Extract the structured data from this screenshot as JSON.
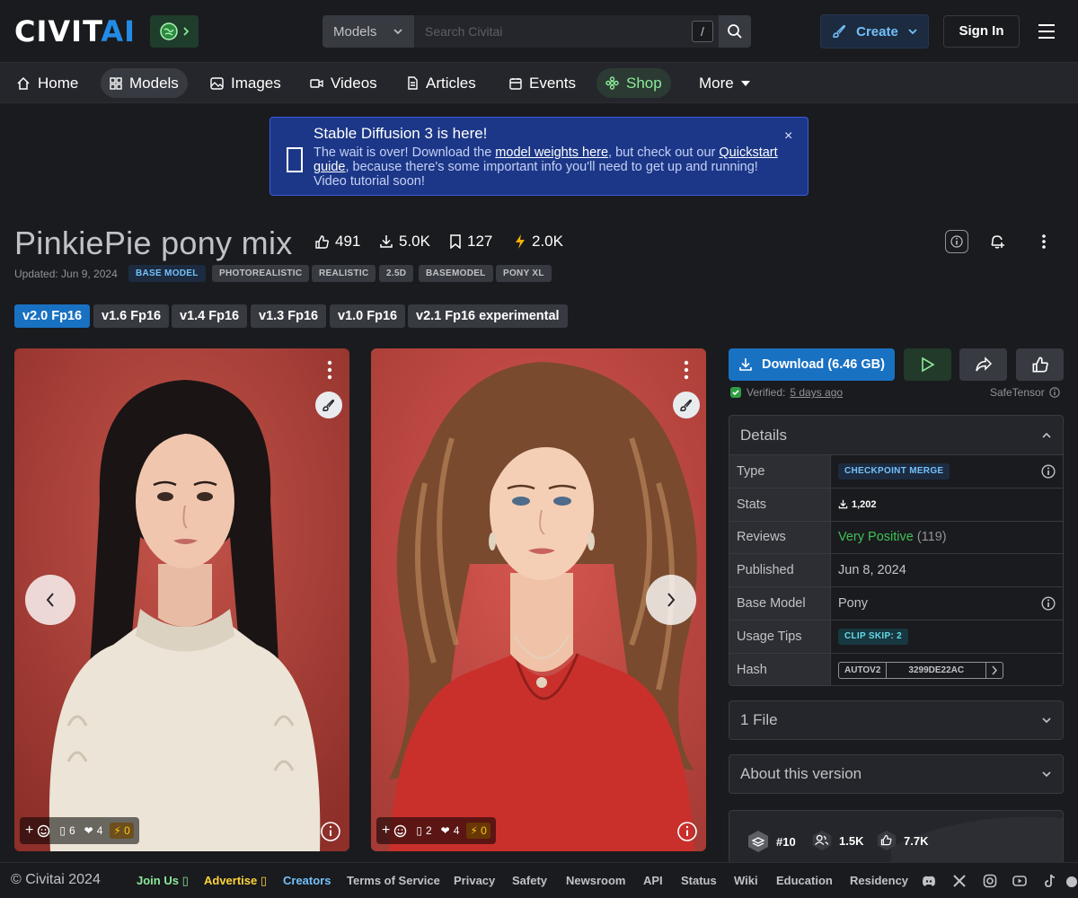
{
  "header": {
    "logo": {
      "part1": "CIVIT",
      "part2": "AI"
    },
    "search": {
      "type_label": "Models",
      "placeholder": "Search Civitai",
      "shortcut": "/"
    },
    "create_label": "Create",
    "signin_label": "Sign In"
  },
  "nav": {
    "items": [
      {
        "label": "Home",
        "icon": "home-icon"
      },
      {
        "label": "Models",
        "icon": "grid-icon",
        "active": true
      },
      {
        "label": "Images",
        "icon": "photo-icon"
      },
      {
        "label": "Videos",
        "icon": "video-icon"
      },
      {
        "label": "Articles",
        "icon": "article-icon"
      },
      {
        "label": "Events",
        "icon": "calendar-icon"
      },
      {
        "label": "Shop",
        "icon": "shop-icon"
      },
      {
        "label": "More",
        "icon": "caret-down-icon"
      }
    ]
  },
  "banner": {
    "title": "Stable Diffusion 3 is here!",
    "text_1": "The wait is over! Download the ",
    "link_1": "model weights here",
    "text_2": ", but check out our ",
    "link_2": "Quickstart guide",
    "text_3": ", because there's some important info you'll need to get up and running! Video tutorial soon!",
    "close": "×"
  },
  "model": {
    "title": "PinkiePie pony mix",
    "stats": {
      "likes": "491",
      "downloads": "5.0K",
      "bookmarks": "127",
      "buzz": "2.0K"
    },
    "updated": "Updated: Jun 9, 2024",
    "base_tag": "BASE MODEL",
    "tags": [
      "PHOTOREALISTIC",
      "REALISTIC",
      "2.5D",
      "BASEMODEL",
      "PONY XL"
    ],
    "versions": [
      "v2.0 Fp16",
      "v1.6 Fp16",
      "v1.4 Fp16",
      "v1.3 Fp16",
      "v1.0 Fp16",
      "v2.1 Fp16 experimental"
    ]
  },
  "gallery": [
    {
      "comments": "6",
      "hearts": "4",
      "buzz": "0"
    },
    {
      "comments": "2",
      "hearts": "4",
      "buzz": "0"
    }
  ],
  "sidebar": {
    "download_label": "Download (6.46 GB)",
    "verified_prefix": "Verified:",
    "verified_when": "5 days ago",
    "safetensor": "SafeTensor",
    "details_title": "Details",
    "rows": {
      "type_key": "Type",
      "type_val": "CHECKPOINT MERGE",
      "stats_key": "Stats",
      "stats_val": "1,202",
      "reviews_key": "Reviews",
      "reviews_val": "Very Positive",
      "reviews_count": "(119)",
      "published_key": "Published",
      "published_val": "Jun 8, 2024",
      "base_key": "Base Model",
      "base_val": "Pony",
      "tips_key": "Usage Tips",
      "tips_val": "CLIP SKIP: 2",
      "hash_key": "Hash",
      "hash_type": "AUTOV2",
      "hash_val": "3299DE22AC"
    },
    "files_label": "1 File",
    "about_label": "About this version",
    "rank": {
      "position": "#10",
      "users": "1.5K",
      "likes": "7.7K"
    }
  },
  "footer": {
    "copyright": "© Civitai 2024",
    "links": [
      "Join Us",
      "Advertise",
      "Creators",
      "Terms of Service",
      "Privacy",
      "Safety",
      "Newsroom",
      "API",
      "Status",
      "Wiki",
      "Education",
      "Residency"
    ]
  },
  "colors": {
    "accent": "#228be6",
    "button_blue": "#1971c2",
    "positive": "#40c057",
    "shop": "#8ce99a",
    "buzz": "#fcc419"
  }
}
